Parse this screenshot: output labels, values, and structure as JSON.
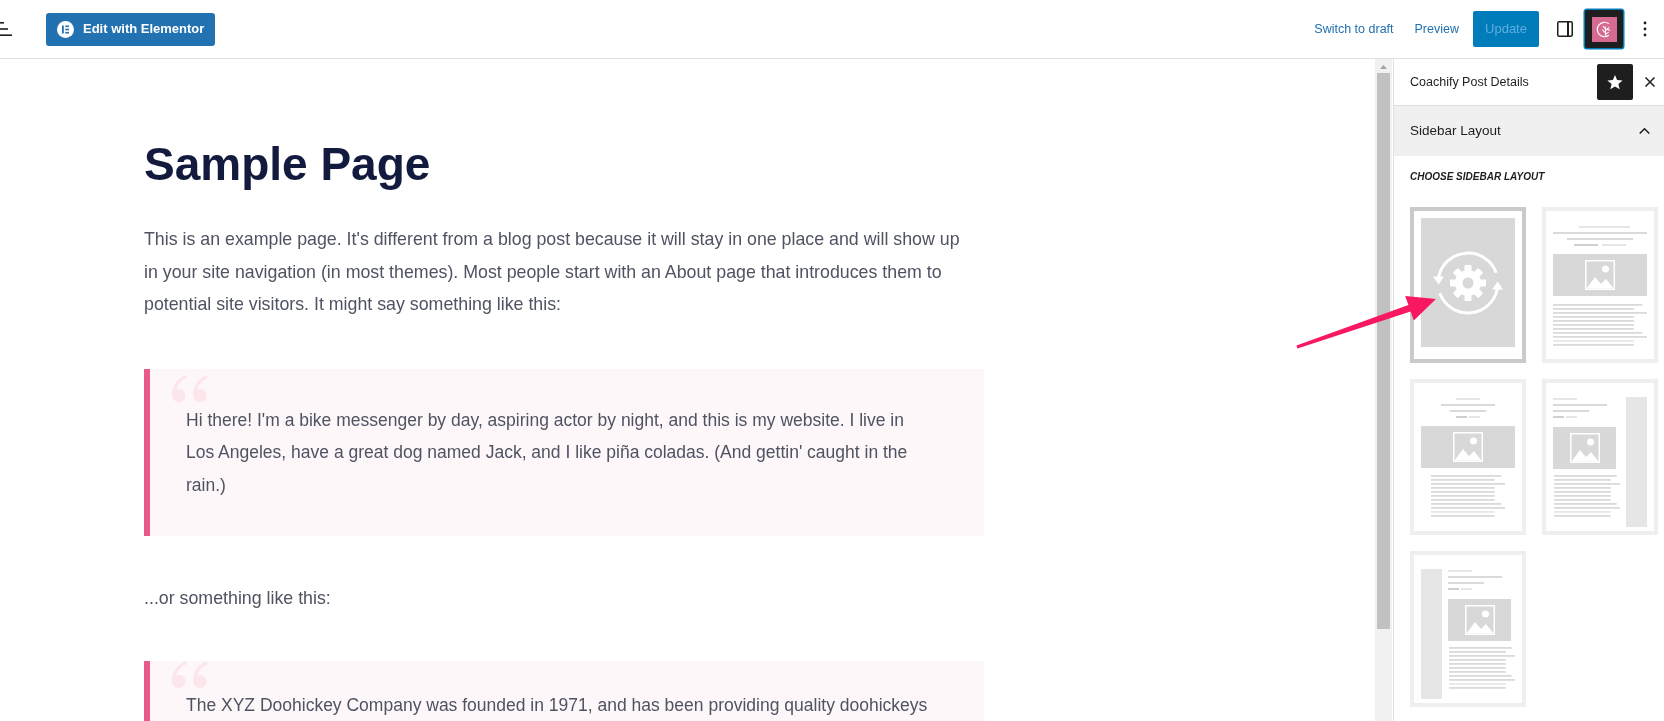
{
  "toolbar": {
    "edit_button": "Edit with Elementor",
    "links": [
      "Switch to draft",
      "Preview"
    ],
    "update_button": {
      "label": "Update",
      "disabled": true
    },
    "plugin_button": {
      "pressed": true
    }
  },
  "document": {
    "title": "Sample Page",
    "blocks": [
      {
        "kind": "paragraph",
        "text": "This is an example page. It's different from a blog post because it will stay in one place and will show up in your site navigation (in most themes). Most people start with an About page that introduces them to potential site visitors. It might say something like this:"
      },
      {
        "kind": "quote",
        "text": "Hi there! I'm a bike messenger by day, aspiring actor by night, and this is my website. I live in Los Angeles, have a great dog named Jack, and I like piña coladas. (And gettin' caught in the rain.)"
      },
      {
        "kind": "paragraph",
        "text": "...or something like this:"
      },
      {
        "kind": "quote",
        "text": "The XYZ Doohickey Company was founded in 1971, and has been providing quality doohickeys"
      }
    ]
  },
  "panel": {
    "title": "Coachify Post Details",
    "pinned": true,
    "section": {
      "title": "Sidebar Layout",
      "expanded": true,
      "label": "CHOOSE SIDEBAR LAYOUT",
      "options": [
        {
          "kind": "default",
          "selected": true
        },
        {
          "kind": "centered-wide",
          "selected": false
        },
        {
          "kind": "centered-narrow",
          "selected": false
        },
        {
          "kind": "right-sidebar",
          "selected": false
        },
        {
          "kind": "left-sidebar",
          "selected": false
        }
      ]
    }
  }
}
